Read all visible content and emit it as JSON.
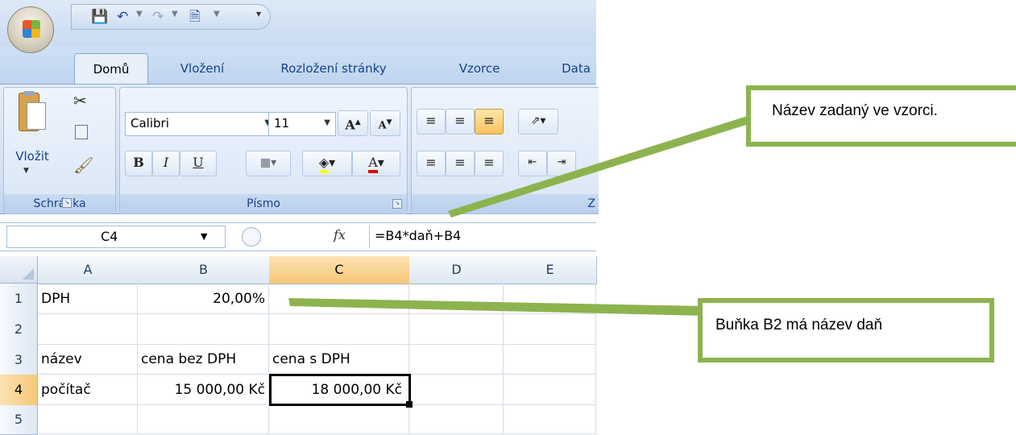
{
  "quick_access": {
    "icons": [
      "save-icon",
      "undo-icon",
      "redo-icon",
      "print-preview-icon",
      "customize-qat-icon"
    ]
  },
  "tabs": [
    {
      "label": "Domů",
      "active": true
    },
    {
      "label": "Vložení"
    },
    {
      "label": "Rozložení stránky"
    },
    {
      "label": "Vzorce"
    },
    {
      "label": "Data"
    }
  ],
  "ribbon": {
    "clipboard": {
      "paste_label": "Vložit",
      "group_label": "Schránka"
    },
    "font": {
      "font_name": "Calibri",
      "font_size": "11",
      "group_label": "Písmo",
      "bold": "B",
      "italic": "I",
      "underline": "U"
    },
    "alignment": {
      "group_label_partial": "Z"
    }
  },
  "formula_bar": {
    "name_box": "C4",
    "fx": "fx",
    "formula": "=B4*daň+B4"
  },
  "sheet": {
    "columns": [
      "A",
      "B",
      "C",
      "D",
      "E"
    ],
    "selected_column": "C",
    "rows": [
      {
        "num": "1",
        "A": "DPH",
        "B": "20,00%",
        "C": "",
        "D": "",
        "E": ""
      },
      {
        "num": "2",
        "A": "",
        "B": "",
        "C": "",
        "D": "",
        "E": ""
      },
      {
        "num": "3",
        "A": "název",
        "B": "cena bez DPH",
        "C": "cena s DPH",
        "D": "",
        "E": ""
      },
      {
        "num": "4",
        "A": "počítač",
        "B": "15 000,00 Kč",
        "C": "18 000,00 Kč",
        "D": "",
        "E": ""
      },
      {
        "num": "5",
        "A": "",
        "B": "",
        "C": "",
        "D": "",
        "E": ""
      }
    ],
    "selected_row": "4",
    "active_cell": "C4"
  },
  "callouts": {
    "formula_name": "Název zadaný ve vzorci.",
    "cell_name": "Buňka B2 má název daň"
  },
  "colors": {
    "accent_green": "#8db34f",
    "ribbon_blue": "#d3e1f4",
    "selection_orange": "#f6c777"
  }
}
